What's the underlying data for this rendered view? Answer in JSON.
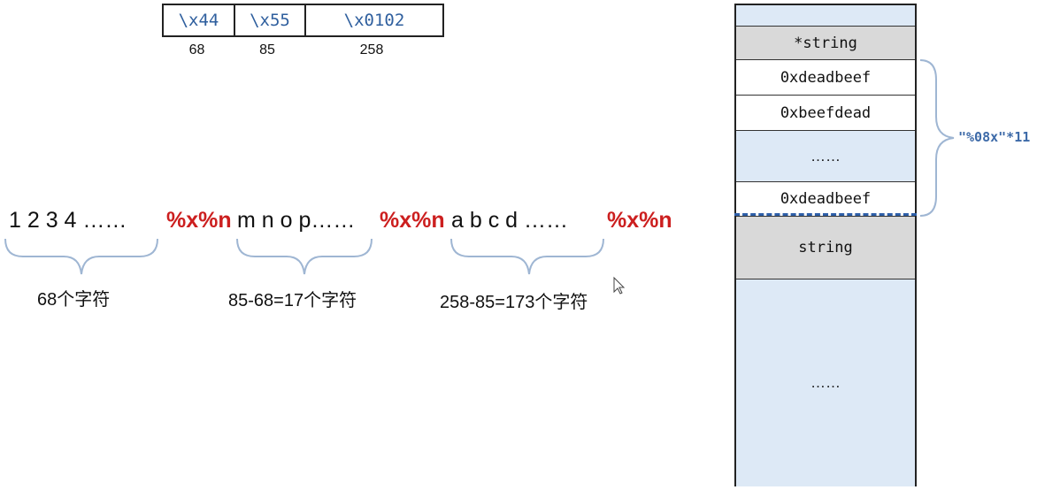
{
  "hex_table": {
    "cells": [
      "\\x44",
      "\\x55",
      "\\x0102"
    ],
    "decimals": [
      "68",
      "85",
      "258"
    ]
  },
  "payload": {
    "seg1": "1 2 3 4 ……",
    "fmt1": "%x%n",
    "seg2": "m n o p……",
    "fmt2": "%x%n",
    "seg3": "a b c d ……",
    "fmt3": "%x%n"
  },
  "counts": {
    "first": "68个字符",
    "second": "85-68=17个字符",
    "third": "258-85=173个字符"
  },
  "stack": {
    "slot_pointer": "*string",
    "slot_deadbeef_1": "0xdeadbeef",
    "slot_beefdead": "0xbeefdead",
    "slot_ellipsis_mid": "……",
    "slot_deadbeef_2": "0xdeadbeef",
    "slot_string": "string",
    "slot_ellipsis_bottom": "……"
  },
  "brace_label": "\"%08x\"*11",
  "colors": {
    "hex_text": "#2f5f9e",
    "format_red": "#cc1f1f",
    "stack_blue": "#dde9f6",
    "stack_gray": "#d9d9d9",
    "brace_blue": "#9fb6d3"
  }
}
